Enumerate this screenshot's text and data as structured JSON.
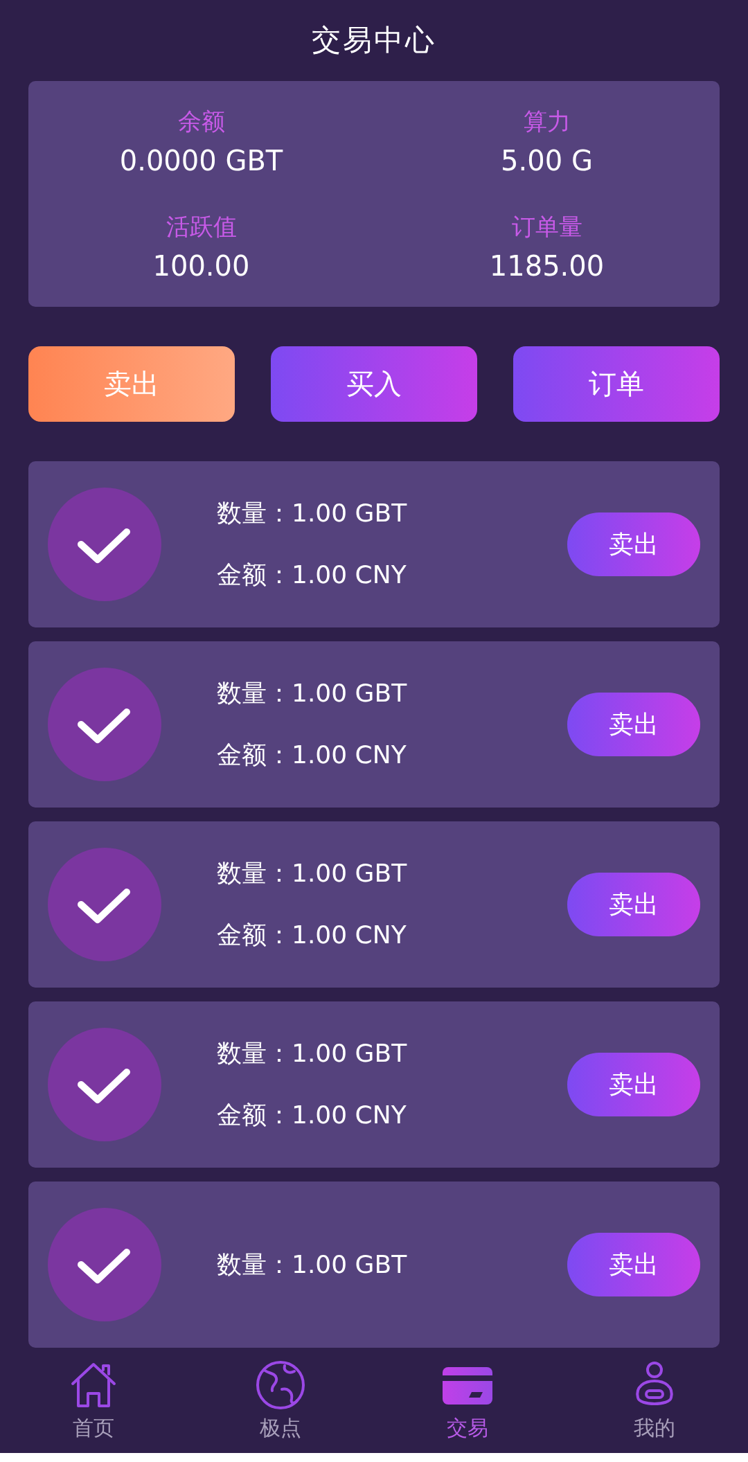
{
  "header": {
    "title": "交易中心"
  },
  "stats": [
    {
      "label": "余额",
      "value": "0.0000 GBT"
    },
    {
      "label": "算力",
      "value": "5.00 G"
    },
    {
      "label": "活跃值",
      "value": "100.00"
    },
    {
      "label": "订单量",
      "value": "1185.00"
    }
  ],
  "actions": [
    {
      "label": "卖出",
      "kind": "sell"
    },
    {
      "label": "买入",
      "kind": "buy"
    },
    {
      "label": "订单",
      "kind": "orders"
    }
  ],
  "orders": [
    {
      "quantity": "数量：1.00 GBT",
      "amount": "金额：1.00 CNY",
      "button": "卖出"
    },
    {
      "quantity": "数量：1.00 GBT",
      "amount": "金额：1.00 CNY",
      "button": "卖出"
    },
    {
      "quantity": "数量：1.00 GBT",
      "amount": "金额：1.00 CNY",
      "button": "卖出"
    },
    {
      "quantity": "数量：1.00 GBT",
      "amount": "金额：1.00 CNY",
      "button": "卖出"
    },
    {
      "quantity": "数量：1.00 GBT",
      "button": "卖出"
    }
  ],
  "tab_bar": [
    {
      "label": "首页",
      "kind": "home",
      "selected": false
    },
    {
      "label": "极点",
      "kind": "globe",
      "selected": false
    },
    {
      "label": "交易",
      "kind": "card",
      "selected": true
    },
    {
      "label": "我的",
      "kind": "user",
      "selected": false
    }
  ]
}
